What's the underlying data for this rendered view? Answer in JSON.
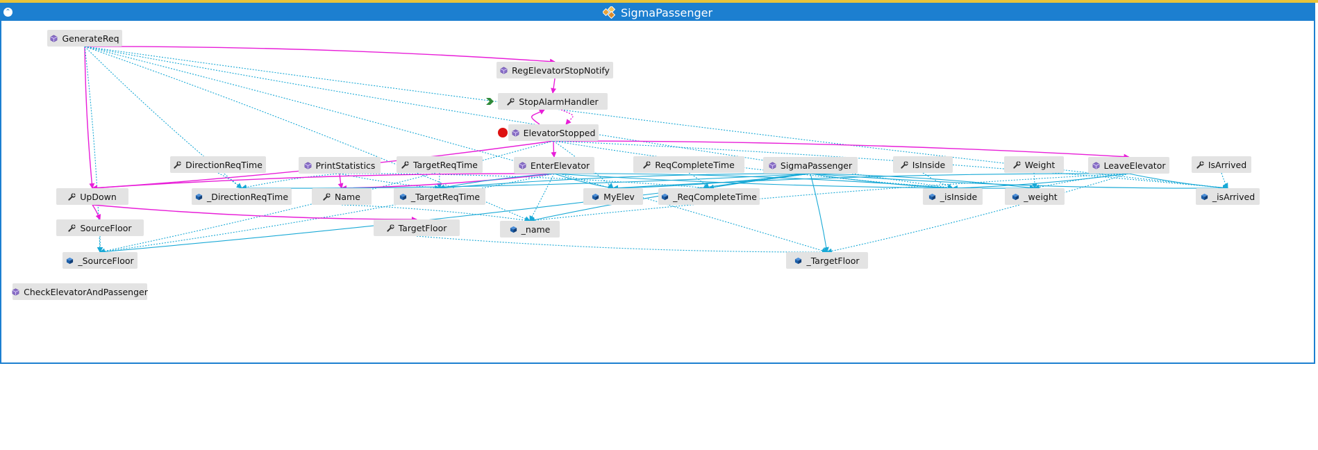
{
  "window": {
    "title": "SigmaPassenger",
    "collapse_glyph": "⌃"
  },
  "colors": {
    "call": "#e81ed8",
    "field": "#19a9d6",
    "titlebar": "#1c7fd0",
    "node_bg": "#e3e3e3",
    "method_icon": "#8a6fc7",
    "property_icon": "#333333",
    "field_icon": "#1d5fa8",
    "event_dot": "#dd1111",
    "entry_marker": "#2f8a3a"
  },
  "nodes": [
    {
      "id": "GenerateReq",
      "label": "GenerateReq",
      "icon": "method-icon"
    },
    {
      "id": "RegElevatorStopNotify",
      "label": "RegElevatorStopNotify",
      "icon": "method-icon"
    },
    {
      "id": "StopAlarmHandler",
      "label": "StopAlarmHandler",
      "icon": "property-icon"
    },
    {
      "id": "ElevatorStopped",
      "label": "ElevatorStopped",
      "icon": "method-icon"
    },
    {
      "id": "DirectionReqTime",
      "label": "DirectionReqTime",
      "icon": "property-icon"
    },
    {
      "id": "PrintStatistics",
      "label": "PrintStatistics",
      "icon": "method-icon"
    },
    {
      "id": "TargetReqTime",
      "label": "TargetReqTime",
      "icon": "property-icon"
    },
    {
      "id": "EnterElevator",
      "label": "EnterElevator",
      "icon": "method-icon"
    },
    {
      "id": "ReqCompleteTime",
      "label": "ReqCompleteTime",
      "icon": "property-icon"
    },
    {
      "id": "SigmaPassenger",
      "label": "SigmaPassenger",
      "icon": "method-icon"
    },
    {
      "id": "IsInside",
      "label": "IsInside",
      "icon": "property-icon"
    },
    {
      "id": "Weight",
      "label": "Weight",
      "icon": "property-icon"
    },
    {
      "id": "LeaveElevator",
      "label": "LeaveElevator",
      "icon": "method-icon"
    },
    {
      "id": "IsArrived",
      "label": "IsArrived",
      "icon": "property-icon"
    },
    {
      "id": "UpDown",
      "label": "UpDown",
      "icon": "property-icon"
    },
    {
      "id": "_DirectionReqTime",
      "label": "_DirectionReqTime",
      "icon": "field-icon"
    },
    {
      "id": "Name",
      "label": "Name",
      "icon": "property-icon"
    },
    {
      "id": "_TargetReqTime",
      "label": "_TargetReqTime",
      "icon": "field-icon"
    },
    {
      "id": "MyElev",
      "label": "MyElev",
      "icon": "field-icon"
    },
    {
      "id": "_ReqCompleteTime",
      "label": "_ReqCompleteTime",
      "icon": "field-icon"
    },
    {
      "id": "_isInside",
      "label": "_isInside",
      "icon": "field-icon"
    },
    {
      "id": "_weight",
      "label": "_weight",
      "icon": "field-icon"
    },
    {
      "id": "_isArrived",
      "label": "_isArrived",
      "icon": "field-icon"
    },
    {
      "id": "SourceFloor",
      "label": "SourceFloor",
      "icon": "property-icon"
    },
    {
      "id": "TargetFloor",
      "label": "TargetFloor",
      "icon": "property-icon"
    },
    {
      "id": "_name",
      "label": "_name",
      "icon": "field-icon"
    },
    {
      "id": "_SourceFloor",
      "label": "_SourceFloor",
      "icon": "field-icon"
    },
    {
      "id": "_TargetFloor",
      "label": "_TargetFloor",
      "icon": "field-icon"
    },
    {
      "id": "CheckElevatorAndPassenger",
      "label": "CheckElevatorAndPassenger",
      "icon": "method-icon"
    }
  ],
  "edges": [
    {
      "from": "GenerateReq",
      "to": "RegElevatorStopNotify",
      "kind": "call"
    },
    {
      "from": "GenerateReq",
      "to": "UpDown",
      "kind": "call"
    },
    {
      "from": "GenerateReq",
      "to": "_SourceFloor",
      "kind": "ref"
    },
    {
      "from": "GenerateReq",
      "to": "_DirectionReqTime",
      "kind": "ref"
    },
    {
      "from": "GenerateReq",
      "to": "_name",
      "kind": "ref"
    },
    {
      "from": "GenerateReq",
      "to": "_isInside",
      "kind": "ref"
    },
    {
      "from": "GenerateReq",
      "to": "_TargetFloor",
      "kind": "ref"
    },
    {
      "from": "GenerateReq",
      "to": "_isArrived",
      "kind": "ref"
    },
    {
      "from": "RegElevatorStopNotify",
      "to": "StopAlarmHandler",
      "kind": "call"
    },
    {
      "from": "StopAlarmHandler",
      "to": "ElevatorStopped",
      "kind": "callref"
    },
    {
      "from": "ElevatorStopped",
      "to": "StopAlarmHandler",
      "kind": "call"
    },
    {
      "from": "ElevatorStopped",
      "to": "EnterElevator",
      "kind": "call"
    },
    {
      "from": "ElevatorStopped",
      "to": "LeaveElevator",
      "kind": "call"
    },
    {
      "from": "ElevatorStopped",
      "to": "UpDown",
      "kind": "call"
    },
    {
      "from": "ElevatorStopped",
      "to": "MyElev",
      "kind": "ref"
    },
    {
      "from": "ElevatorStopped",
      "to": "_isInside",
      "kind": "ref"
    },
    {
      "from": "ElevatorStopped",
      "to": "_isArrived",
      "kind": "ref"
    },
    {
      "from": "ElevatorStopped",
      "to": "_SourceFloor",
      "kind": "ref"
    },
    {
      "from": "DirectionReqTime",
      "to": "_DirectionReqTime",
      "kind": "ref"
    },
    {
      "from": "PrintStatistics",
      "to": "Name",
      "kind": "call"
    },
    {
      "from": "PrintStatistics",
      "to": "_DirectionReqTime",
      "kind": "ref"
    },
    {
      "from": "PrintStatistics",
      "to": "_TargetReqTime",
      "kind": "ref"
    },
    {
      "from": "PrintStatistics",
      "to": "_ReqCompleteTime",
      "kind": "ref"
    },
    {
      "from": "TargetReqTime",
      "to": "_TargetReqTime",
      "kind": "ref"
    },
    {
      "from": "EnterElevator",
      "to": "UpDown",
      "kind": "call"
    },
    {
      "from": "EnterElevator",
      "to": "Name",
      "kind": "call"
    },
    {
      "from": "EnterElevator",
      "to": "_TargetReqTime",
      "kind": "field"
    },
    {
      "from": "EnterElevator",
      "to": "MyElev",
      "kind": "field"
    },
    {
      "from": "EnterElevator",
      "to": "_isInside",
      "kind": "field"
    },
    {
      "from": "EnterElevator",
      "to": "_weight",
      "kind": "field"
    },
    {
      "from": "EnterElevator",
      "to": "_name",
      "kind": "ref"
    },
    {
      "from": "EnterElevator",
      "to": "_SourceFloor",
      "kind": "ref"
    },
    {
      "from": "ReqCompleteTime",
      "to": "_ReqCompleteTime",
      "kind": "ref"
    },
    {
      "from": "SigmaPassenger",
      "to": "_DirectionReqTime",
      "kind": "field"
    },
    {
      "from": "SigmaPassenger",
      "to": "_TargetReqTime",
      "kind": "field"
    },
    {
      "from": "SigmaPassenger",
      "to": "MyElev",
      "kind": "field"
    },
    {
      "from": "SigmaPassenger",
      "to": "_ReqCompleteTime",
      "kind": "field"
    },
    {
      "from": "SigmaPassenger",
      "to": "_isInside",
      "kind": "field"
    },
    {
      "from": "SigmaPassenger",
      "to": "_weight",
      "kind": "field"
    },
    {
      "from": "SigmaPassenger",
      "to": "_isArrived",
      "kind": "field"
    },
    {
      "from": "SigmaPassenger",
      "to": "_name",
      "kind": "field"
    },
    {
      "from": "SigmaPassenger",
      "to": "_SourceFloor",
      "kind": "field"
    },
    {
      "from": "SigmaPassenger",
      "to": "_TargetFloor",
      "kind": "field"
    },
    {
      "from": "IsInside",
      "to": "_isInside",
      "kind": "ref"
    },
    {
      "from": "Weight",
      "to": "_weight",
      "kind": "ref"
    },
    {
      "from": "LeaveElevator",
      "to": "_isInside",
      "kind": "field"
    },
    {
      "from": "LeaveElevator",
      "to": "_weight",
      "kind": "ref"
    },
    {
      "from": "LeaveElevator",
      "to": "_isArrived",
      "kind": "field"
    },
    {
      "from": "LeaveElevator",
      "to": "MyElev",
      "kind": "field"
    },
    {
      "from": "LeaveElevator",
      "to": "_TargetFloor",
      "kind": "ref"
    },
    {
      "from": "LeaveElevator",
      "to": "_name",
      "kind": "ref"
    },
    {
      "from": "IsArrived",
      "to": "_isArrived",
      "kind": "ref"
    },
    {
      "from": "UpDown",
      "to": "SourceFloor",
      "kind": "call"
    },
    {
      "from": "UpDown",
      "to": "TargetFloor",
      "kind": "call"
    },
    {
      "from": "SourceFloor",
      "to": "_SourceFloor",
      "kind": "ref"
    },
    {
      "from": "TargetFloor",
      "to": "_TargetFloor",
      "kind": "ref"
    },
    {
      "from": "Name",
      "to": "_name",
      "kind": "ref"
    }
  ]
}
